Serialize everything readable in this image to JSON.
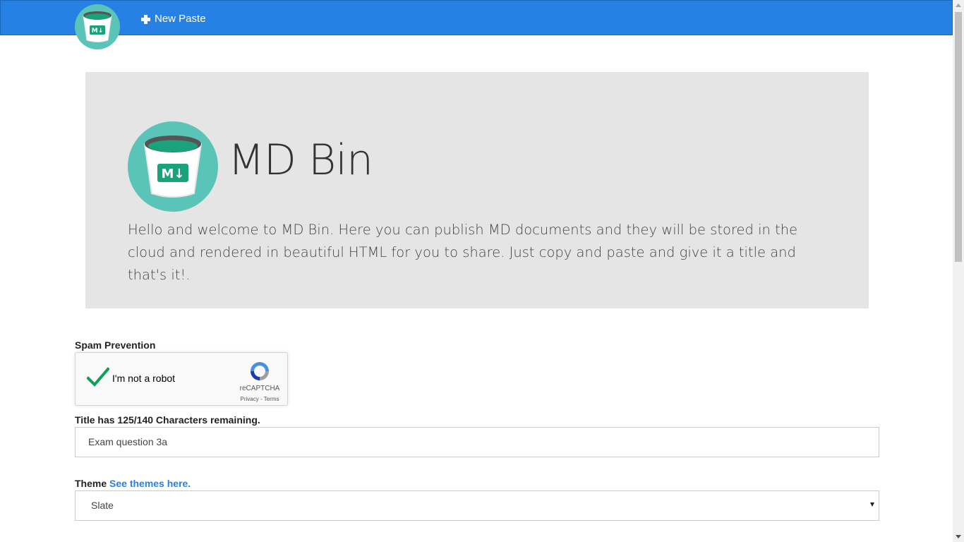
{
  "navbar": {
    "logo_icon": "md-bin-bucket-logo",
    "new_paste_label": "New Paste",
    "new_paste_icon": "plus-icon",
    "background_color": "#2780e3"
  },
  "hero": {
    "logo_icon": "md-bin-bucket-logo",
    "logo_text": "M↓",
    "title": "MD Bin",
    "description": "Hello and welcome to MD Bin. Here you can publish MD documents and they will be stored in the cloud and rendered in beautiful HTML for you to share. Just copy and paste and give it a title and that's it!.",
    "background_color": "#e5e5e5"
  },
  "form": {
    "spam_label": "Spam Prevention",
    "recaptcha": {
      "checkbox_label": "I'm not a robot",
      "checked": true,
      "brand": "reCAPTCHA",
      "links": "Privacy - Terms",
      "check_icon": "checkmark-icon",
      "logo_icon": "recaptcha-logo-icon"
    },
    "title_label": "Title has 125/140 Characters remaining.",
    "title_value": "Exam question 3a",
    "theme_label": "Theme",
    "theme_link": "See themes here.",
    "theme_value": "Slate"
  },
  "colors": {
    "accent": "#2780e3",
    "logo_teal": "#5bc4b8",
    "bucket_green": "#1aa37a",
    "check_green": "#0f9d58"
  }
}
